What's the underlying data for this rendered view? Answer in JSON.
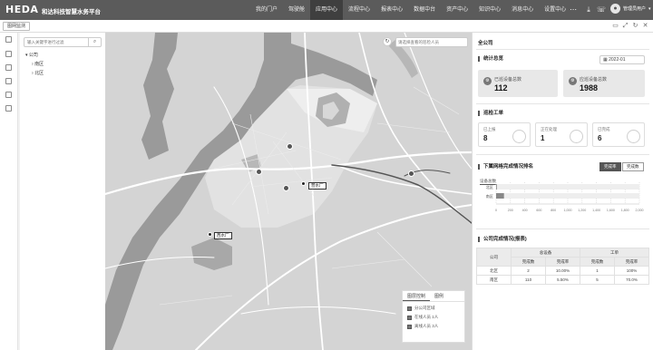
{
  "app": {
    "logo": "HEDA",
    "product_name": "和达科技智慧水务平台"
  },
  "nav": [
    "我的门户",
    "驾驶舱",
    "应用中心",
    "流程中心",
    "报表中心",
    "数据中台",
    "资产中心",
    "知识中心",
    "消息中心",
    "设置中心"
  ],
  "nav_active_index": 2,
  "user": {
    "name": "管理员用户",
    "avatar_icon": "user-icon"
  },
  "subbar": {
    "tab_label": "图网监测"
  },
  "tree": {
    "search_placeholder": "输入关键字进行过滤",
    "root": "公司",
    "children": [
      "南区",
      "北区"
    ]
  },
  "map": {
    "search_placeholder": "请选择查看的巡检人员",
    "plants": [
      "营水厂",
      "西水厂"
    ],
    "legend": {
      "tabs": [
        "图层控制",
        "图例"
      ],
      "items": [
        "分公司区域",
        "在线人员 1人",
        "离线人员 3人"
      ]
    }
  },
  "panel": {
    "title": "全公司",
    "stats": {
      "title": "统计总览",
      "date": "2022-01",
      "cards": [
        {
          "label": "已巡设备总数",
          "value": "112",
          "icon": "device-icon"
        },
        {
          "label": "应巡设备总数",
          "value": "1988",
          "icon": "device-icon"
        }
      ]
    },
    "workorders": {
      "title": "巡检工单",
      "items": [
        {
          "label": "已上报",
          "value": "8"
        },
        {
          "label": "正在处理",
          "value": "1"
        },
        {
          "label": "已完成",
          "value": "6"
        }
      ]
    },
    "ranking": {
      "title": "下属网格完成情况排名",
      "toggles": [
        "完成率",
        "完成数"
      ],
      "subtitle": "设备总数"
    },
    "completion": {
      "title": "公司完成情况(报表)",
      "headers": [
        "公司",
        "总设备",
        "工单"
      ],
      "subheaders": [
        "完成数",
        "完成率",
        "完成数",
        "完成率"
      ],
      "rows": [
        [
          "北区",
          "2",
          "10.00%",
          "1",
          "100%"
        ],
        [
          "南区",
          "110",
          "5.50%",
          "5",
          "70.0%"
        ]
      ]
    }
  },
  "chart_data": {
    "type": "bar",
    "orientation": "horizontal",
    "title": "设备总数",
    "categories": [
      "北区",
      "南区"
    ],
    "series": [
      {
        "values": [
          2,
          110
        ]
      }
    ],
    "xlim": [
      0,
      2000
    ],
    "xticks": [
      "0",
      "200",
      "400",
      "600",
      "800",
      "1,000",
      "1,200",
      "1,400",
      "1,600",
      "1,800",
      "2,000"
    ],
    "grid": true
  }
}
